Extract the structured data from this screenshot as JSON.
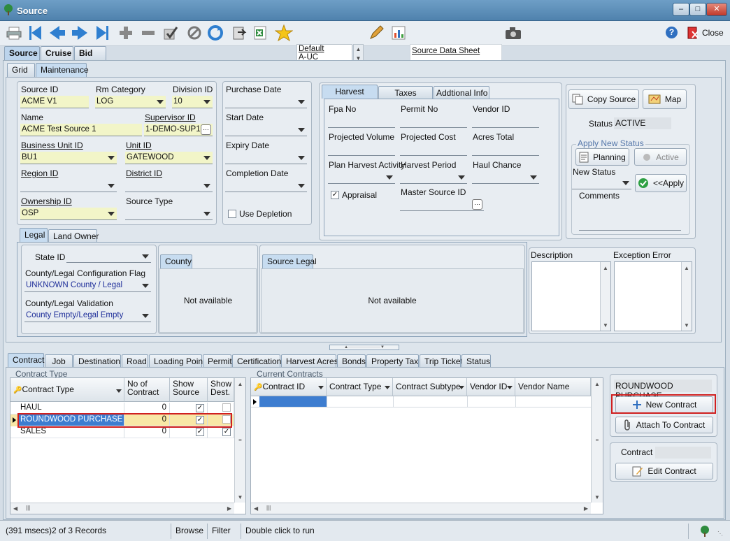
{
  "window": {
    "title": "Source"
  },
  "toolbar": {
    "list_items": [
      "Default",
      "A-UC"
    ],
    "report_label": "Source Data Sheet",
    "close_label": "Close"
  },
  "main_tabs": [
    "Source",
    "Cruise",
    "Bid"
  ],
  "sub_tabs": [
    "Grid",
    "Maintenance"
  ],
  "form": {
    "source_id_label": "Source ID",
    "source_id": "ACME V1",
    "rm_category_label": "Rm Category",
    "rm_category": "LOG",
    "division_id_label": "Division ID",
    "division_id": "10",
    "name_label": "Name",
    "name": "ACME Test Source 1",
    "supervisor_label": "Supervisor ID",
    "supervisor": "1-DEMO-SUP1",
    "bu_label": "Business Unit ID",
    "bu": "BU1",
    "unit_label": "Unit ID",
    "unit": "GATEWOOD",
    "region_label": "Region ID",
    "district_label": "District ID",
    "ownership_label": "Ownership ID",
    "ownership": "OSP",
    "source_type_label": "Source Type",
    "purchase_date_label": "Purchase Date",
    "start_date_label": "Start Date",
    "expiry_date_label": "Expiry Date",
    "completion_date_label": "Completion Date",
    "use_depletion_label": "Use Depletion"
  },
  "harvest": {
    "tabs": [
      "Harvest",
      "Taxes",
      "Addtional Info"
    ],
    "fpa_label": "Fpa No",
    "permit_label": "Permit No",
    "vendor_label": "Vendor ID",
    "proj_volume_label": "Projected Volume",
    "proj_cost_label": "Projected Cost",
    "acres_label": "Acres Total",
    "plan_activity_label": "Plan Harvest Activity",
    "period_label": "Harvest Period",
    "haul_label": "Haul Chance",
    "appraisal_label": "Appraisal",
    "master_label": "Master Source ID"
  },
  "side": {
    "copy_label": "Copy Source",
    "map_label": "Map",
    "status_label": "Status",
    "status_value": "ACTIVE",
    "apply_group_label": "Apply New Status",
    "planning_label": "Planning",
    "active_label": "Active",
    "new_status_label": "New Status",
    "apply_label": "<<Apply",
    "comments_label": "Comments"
  },
  "legal": {
    "tabs": [
      "Legal",
      "Land Owner"
    ],
    "state_label": "State ID",
    "flag_label": "County/Legal Configuration Flag",
    "flag_value": "UNKNOWN County / Legal",
    "validation_label": "County/Legal Validation",
    "validation_value": "County Empty/Legal Empty",
    "county_tab": "County",
    "county_na": "Not available",
    "source_legal_tab": "Source Legal",
    "source_legal_na": "Not available",
    "description_label": "Description",
    "exception_label": "Exception Error"
  },
  "bottom_tabs": [
    "Contract",
    "Job",
    "Destination",
    "Road",
    "Loading Point",
    "Permit",
    "Certification",
    "Harvest Acres",
    "Bonds",
    "Property Tax",
    "Trip Ticket",
    "Status"
  ],
  "contract_type": {
    "group_label": "Contract Type",
    "headers": [
      "Contract Type",
      "No of Contract",
      "Show Source",
      "Show Dest."
    ],
    "rows": [
      {
        "type": "HAUL",
        "count": "0",
        "show_source": true,
        "show_dest": false
      },
      {
        "type": "ROUNDWOOD PURCHASE",
        "count": "0",
        "show_source": true,
        "show_dest": false
      },
      {
        "type": "SALES",
        "count": "0",
        "show_source": true,
        "show_dest": true
      }
    ]
  },
  "current_contracts": {
    "group_label": "Current Contracts",
    "headers": [
      "Contract ID",
      "Contract Type",
      "Contract Subtype",
      "Vendor ID",
      "Vendor Name"
    ]
  },
  "actions": {
    "selected_type": "ROUNDWOOD PURCHASE",
    "new_contract": "New Contract",
    "attach_contract": "Attach To Contract",
    "contract_label": "Contract",
    "edit_contract": "Edit Contract"
  },
  "statusbar": {
    "records": "(391 msecs)2 of 3 Records",
    "mode": "Browse",
    "filter": "Filter",
    "hint": "Double click to run"
  }
}
